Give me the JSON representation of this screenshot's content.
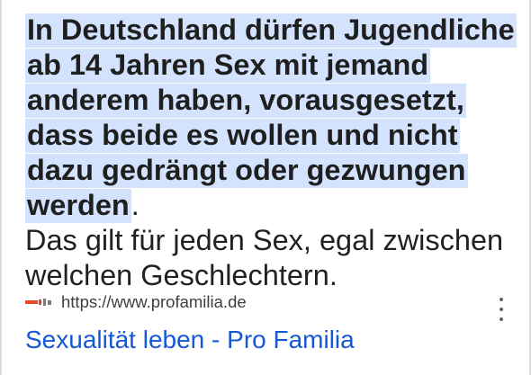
{
  "snippet": {
    "highlighted": "In Deutschland dürfen Jugendliche ab 14 Jahren Sex mit jemand anderem haben, vorausgesetzt, dass beide es wollen und nicht dazu gedrängt oder gezwungen werden",
    "period": ".",
    "plain": "Das gilt für jeden Sex, egal zwischen welchen Geschlechtern."
  },
  "source": {
    "url": "https://www.profamilia.de",
    "icon": "profamilia-logo-icon"
  },
  "result": {
    "title": "Sexualität leben - Pro Familia"
  },
  "colors": {
    "highlight": "#d3e3fd",
    "link": "#1558d6"
  }
}
